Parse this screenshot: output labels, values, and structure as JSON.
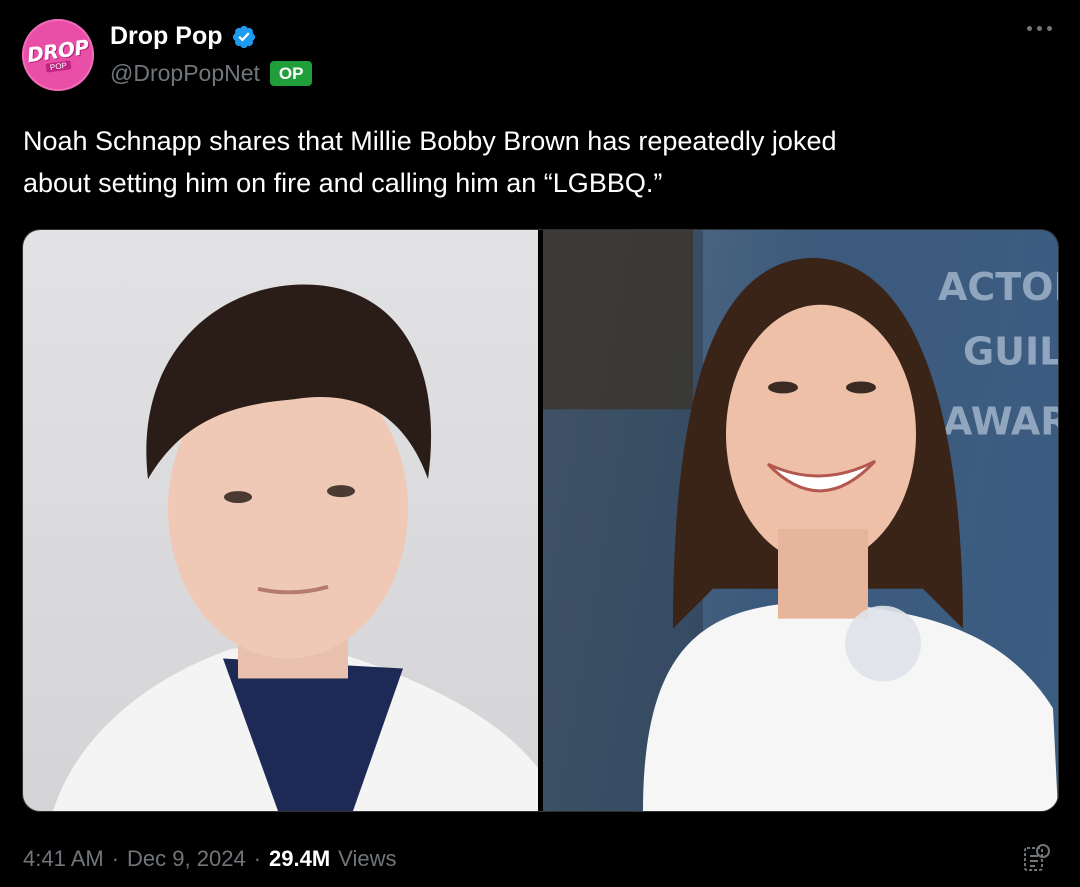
{
  "author": {
    "display_name": "Drop Pop",
    "handle": "@DropPopNet",
    "badge": "OP",
    "avatar_text": "DROP",
    "avatar_subtext": "POP"
  },
  "tweet": {
    "text": "Noah Schnapp shares that Millie Bobby Brown has repeatedly joked\nabout setting him on fire and calling him an “LGBBQ.”"
  },
  "media": {
    "backdrop_text": [
      "ACTORS",
      "GUILD",
      "AWARDS"
    ]
  },
  "meta": {
    "time": "4:41 AM",
    "sep1": "·",
    "date": "Dec 9, 2024",
    "sep2": "·",
    "views_count": "29.4M",
    "views_label": "Views"
  },
  "icons": {
    "verified": "verified-badge-icon",
    "more": "more-options-icon",
    "analytics": "analytics-icon"
  },
  "colors": {
    "background": "#000000",
    "avatar": "#ea4fa8",
    "verified": "#1d9bf0",
    "op_badge": "#1f9e3a"
  }
}
